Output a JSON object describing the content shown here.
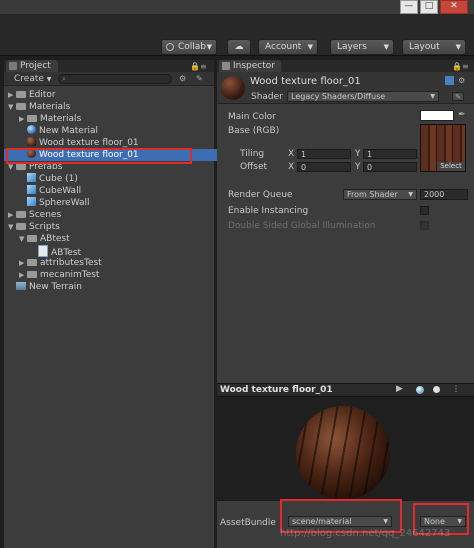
{
  "window": {
    "minimize": "—",
    "maximize": "□",
    "close": "✕"
  },
  "toolbar": {
    "collab_label": "Collab",
    "account_label": "Account",
    "layers_label": "Layers",
    "layout_label": "Layout"
  },
  "project": {
    "tab_label": "Project",
    "create_label": "Create",
    "tree": [
      {
        "label": "Editor",
        "depth": 0,
        "expanded": false,
        "icon": "folder"
      },
      {
        "label": "Materials",
        "depth": 0,
        "expanded": true,
        "icon": "folder"
      },
      {
        "label": "Materials",
        "depth": 1,
        "expanded": false,
        "icon": "folder"
      },
      {
        "label": "New Material",
        "depth": 1,
        "icon": "material-sphere"
      },
      {
        "label": "Wood texture floor_01",
        "depth": 1,
        "icon": "wood-texture"
      },
      {
        "label": "Wood texture floor_01",
        "depth": 1,
        "icon": "wood-material",
        "selected": true
      },
      {
        "label": "Prefabs",
        "depth": 0,
        "expanded": true,
        "icon": "folder"
      },
      {
        "label": "Cube (1)",
        "depth": 1,
        "icon": "prefab-cube"
      },
      {
        "label": "CubeWall",
        "depth": 1,
        "icon": "prefab-cube"
      },
      {
        "label": "SphereWall",
        "depth": 1,
        "icon": "prefab-cube"
      },
      {
        "label": "Scenes",
        "depth": 0,
        "expanded": false,
        "icon": "folder"
      },
      {
        "label": "Scripts",
        "depth": 0,
        "expanded": true,
        "icon": "folder"
      },
      {
        "label": "ABtest",
        "depth": 1,
        "expanded": true,
        "icon": "folder"
      },
      {
        "label": "ABTest",
        "depth": 2,
        "icon": "script"
      },
      {
        "label": "attributesTest",
        "depth": 1,
        "expanded": false,
        "icon": "folder"
      },
      {
        "label": "mecanimTest",
        "depth": 1,
        "expanded": false,
        "icon": "folder"
      },
      {
        "label": "New Terrain",
        "depth": 0,
        "icon": "terrain"
      }
    ]
  },
  "inspector": {
    "tab_label": "Inspector",
    "title": "Wood texture floor_01",
    "shader_label": "Shader",
    "shader_value": "Legacy Shaders/Diffuse",
    "main_color_label": "Main Color",
    "base_label": "Base (RGB)",
    "tiling_label": "Tiling",
    "offset_label": "Offset",
    "tiling_x": "1",
    "tiling_y": "1",
    "offset_x": "0",
    "offset_y": "0",
    "x_label": "X",
    "y_label": "Y",
    "select_label": "Select",
    "render_queue_label": "Render Queue",
    "render_queue_mode": "From Shader",
    "render_queue_value": "2000",
    "enable_instancing_label": "Enable Instancing",
    "double_sided_label": "Double Sided Global Illumination"
  },
  "preview": {
    "title": "Wood texture floor_01",
    "assetbundle_label": "AssetBundle",
    "assetbundle_value": "scene/material",
    "variant_value": "None",
    "watermark": "http://blog.csdn.net/qq_24642743"
  },
  "colors": {
    "selection": "#3d6eb3",
    "highlight_box": "#e02b2b"
  }
}
